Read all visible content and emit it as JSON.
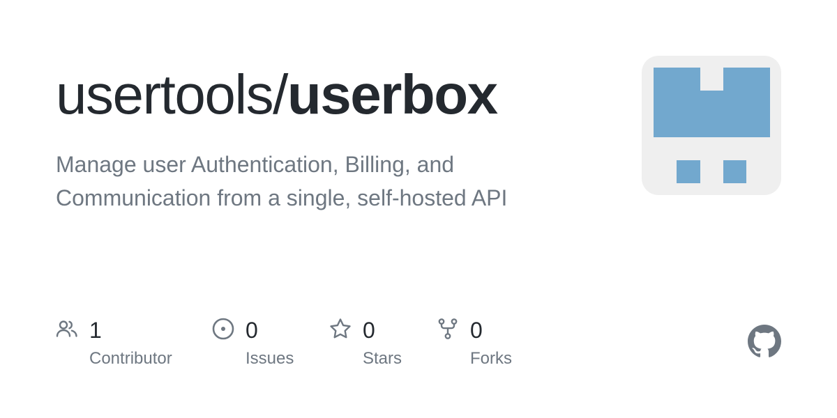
{
  "header": {
    "owner": "usertools/",
    "repo": "userbox"
  },
  "description_line1": "Manage user Authentication, Billing, and",
  "description_line2": "Communication from a single, self-hosted API",
  "avatar": {
    "icon": "identicon",
    "background": "#efefef",
    "foreground": "#72a8ce"
  },
  "stats": {
    "contributors": {
      "count": "1",
      "label": "Contributor",
      "icon": "people-icon"
    },
    "issues": {
      "count": "0",
      "label": "Issues",
      "icon": "issue-opened-icon"
    },
    "stars": {
      "count": "0",
      "label": "Stars",
      "icon": "star-icon"
    },
    "forks": {
      "count": "0",
      "label": "Forks",
      "icon": "repo-forked-icon"
    }
  },
  "colors": {
    "title": "#24292f",
    "muted": "#6e7781",
    "icon": "#6e7781"
  },
  "footer": {
    "logo": "github-mark-icon"
  }
}
